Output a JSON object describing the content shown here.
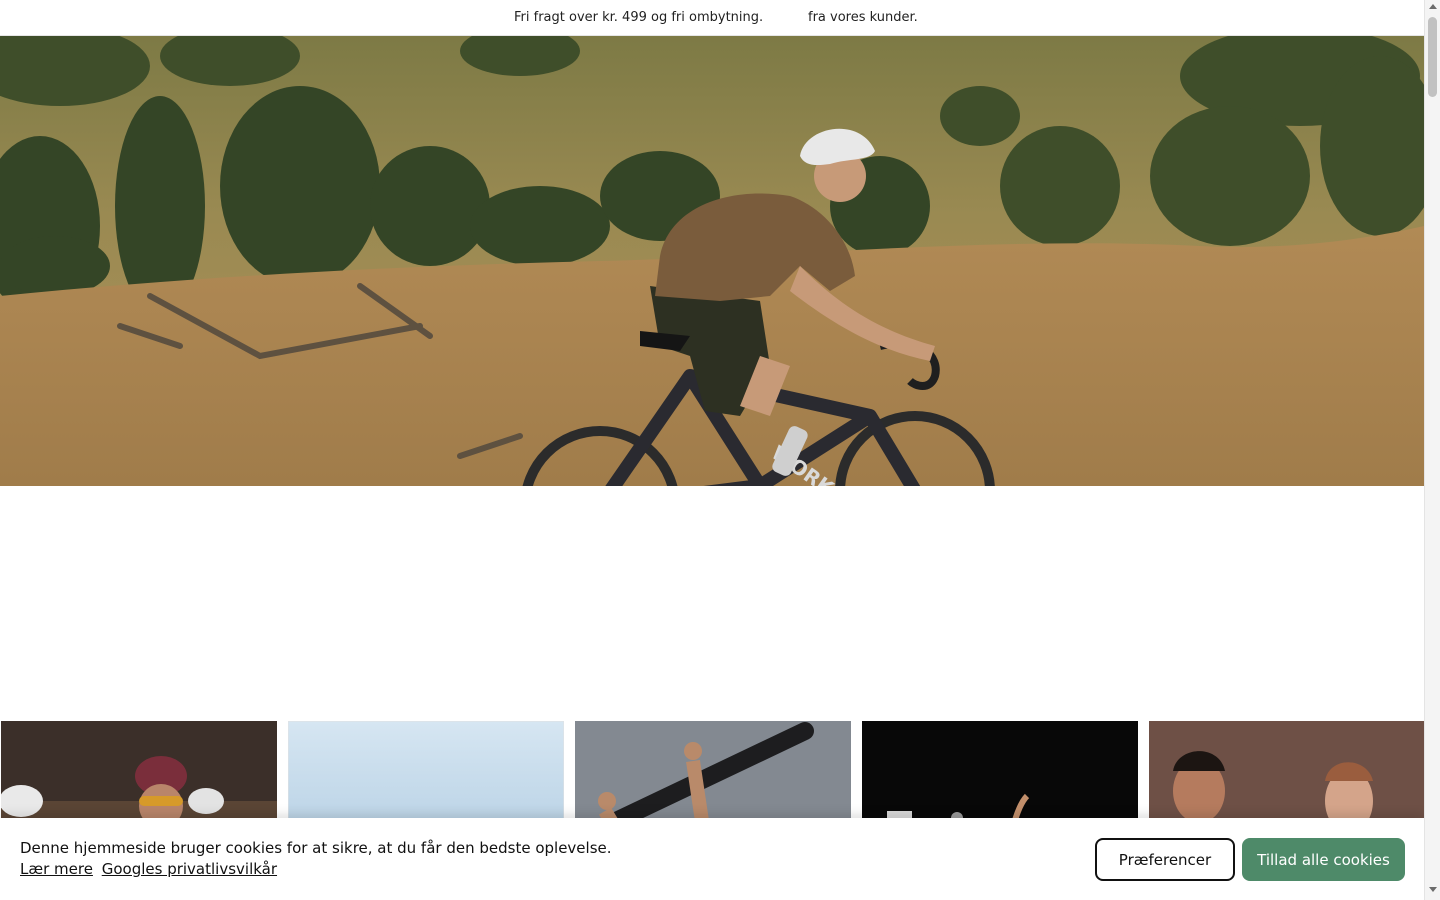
{
  "announcement": {
    "message_shipping": "Fri fragt over kr. 499 og fri ombytning.",
    "message_reviews": "fra vores kunder."
  },
  "hero": {
    "image": "cyclist-on-gravel-bike-in-hilly-grassland",
    "bike_text": "WORKS"
  },
  "category_tiles": [
    {
      "image": "group-road-cyclists"
    },
    {
      "image": "sky-landscape"
    },
    {
      "image": "person-lifting-bike-frame"
    },
    {
      "image": "dark-product-shot"
    },
    {
      "image": "two-people-portrait"
    }
  ],
  "cookie_banner": {
    "message": "Denne hjemmeside bruger cookies for at sikre, at du får den bedste oplevelse.",
    "learn_more_label": "Lær mere",
    "privacy_label": "Googles privatlivsvilkår",
    "preferences_label": "Præferencer",
    "allow_all_label": "Tillad alle cookies"
  },
  "colors": {
    "accent_green": "#4e8a69",
    "background": "#ffffff"
  }
}
